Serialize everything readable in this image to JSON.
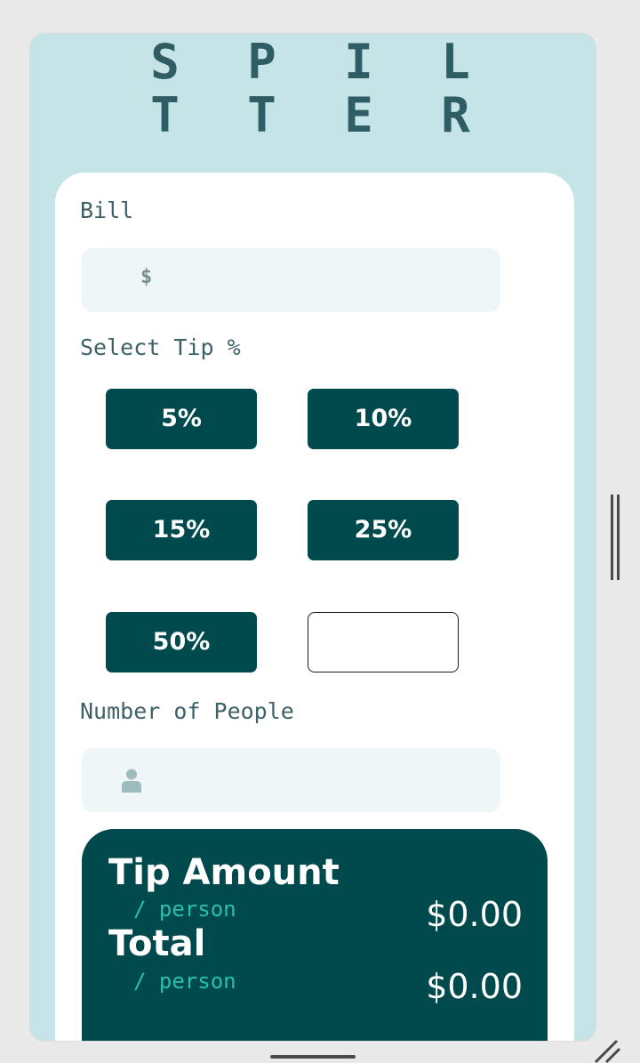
{
  "app": {
    "logo_line1": "S P I L",
    "logo_line2": "T T E R"
  },
  "bill": {
    "label": "Bill",
    "currency_symbol": "$",
    "value": "",
    "placeholder": ""
  },
  "tip": {
    "label": "Select Tip %",
    "options": [
      "5%",
      "10%",
      "15%",
      "25%",
      "50%"
    ],
    "custom_value": "",
    "custom_placeholder": ""
  },
  "people": {
    "label": "Number of People",
    "icon": "person-icon",
    "value": "",
    "placeholder": ""
  },
  "results": {
    "tip_amount_label": "Tip Amount",
    "tip_amount_sub": "/ person",
    "tip_amount_value": "$0.00",
    "total_label": "Total",
    "total_sub": "/ person",
    "total_value": "$0.00"
  },
  "colors": {
    "background": "#c5e4e7",
    "primary": "#00494d",
    "accent": "#26c0ab",
    "input_bg": "#eef6f7"
  }
}
